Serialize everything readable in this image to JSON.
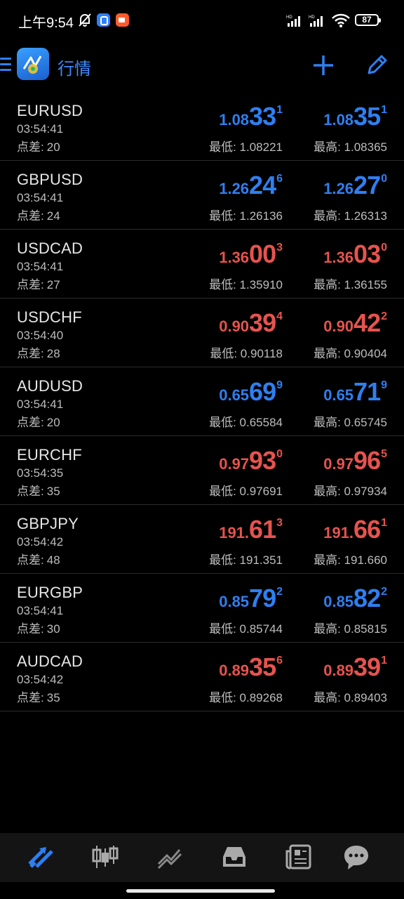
{
  "status_bar": {
    "time": "上午9:54",
    "battery": "87",
    "colors": {
      "app1": "#2f80ff",
      "app2": "#ff5a2c"
    },
    "icons": [
      "bell-off-icon",
      "app-icon",
      "video-icon",
      "hd-signal-icon",
      "hd-signal-icon",
      "wifi-icon",
      "battery-icon"
    ]
  },
  "app_bar": {
    "title": "行情",
    "icons": [
      "menu-icon",
      "metatrader-logo",
      "add-icon",
      "edit-icon"
    ]
  },
  "accent_color": "#2f7ff0",
  "down_color": "#e6534e",
  "quotes": [
    {
      "symbol": "EURUSD",
      "time": "03:54:41",
      "spread_label": "点差:",
      "spread": "20",
      "bid": {
        "pre": "1.08",
        "big": "33",
        "sup": "1",
        "color": "blue"
      },
      "ask": {
        "pre": "1.08",
        "big": "35",
        "sup": "1",
        "color": "blue"
      },
      "low": "最低: 1.08221",
      "high": "最高: 1.08365"
    },
    {
      "symbol": "GBPUSD",
      "time": "03:54:41",
      "spread_label": "点差:",
      "spread": "24",
      "bid": {
        "pre": "1.26",
        "big": "24",
        "sup": "6",
        "color": "blue"
      },
      "ask": {
        "pre": "1.26",
        "big": "27",
        "sup": "0",
        "color": "blue"
      },
      "low": "最低: 1.26136",
      "high": "最高: 1.26313"
    },
    {
      "symbol": "USDCAD",
      "time": "03:54:41",
      "spread_label": "点差:",
      "spread": "27",
      "bid": {
        "pre": "1.36",
        "big": "00",
        "sup": "3",
        "color": "red"
      },
      "ask": {
        "pre": "1.36",
        "big": "03",
        "sup": "0",
        "color": "red"
      },
      "low": "最低: 1.35910",
      "high": "最高: 1.36155"
    },
    {
      "symbol": "USDCHF",
      "time": "03:54:40",
      "spread_label": "点差:",
      "spread": "28",
      "bid": {
        "pre": "0.90",
        "big": "39",
        "sup": "4",
        "color": "red"
      },
      "ask": {
        "pre": "0.90",
        "big": "42",
        "sup": "2",
        "color": "red"
      },
      "low": "最低: 0.90118",
      "high": "最高: 0.90404"
    },
    {
      "symbol": "AUDUSD",
      "time": "03:54:41",
      "spread_label": "点差:",
      "spread": "20",
      "bid": {
        "pre": "0.65",
        "big": "69",
        "sup": "9",
        "color": "blue"
      },
      "ask": {
        "pre": "0.65",
        "big": "71",
        "sup": "9",
        "color": "blue"
      },
      "low": "最低: 0.65584",
      "high": "最高: 0.65745"
    },
    {
      "symbol": "EURCHF",
      "time": "03:54:35",
      "spread_label": "点差:",
      "spread": "35",
      "bid": {
        "pre": "0.97",
        "big": "93",
        "sup": "0",
        "color": "red"
      },
      "ask": {
        "pre": "0.97",
        "big": "96",
        "sup": "5",
        "color": "red"
      },
      "low": "最低: 0.97691",
      "high": "最高: 0.97934"
    },
    {
      "symbol": "GBPJPY",
      "time": "03:54:42",
      "spread_label": "点差:",
      "spread": "48",
      "bid": {
        "pre": "191.",
        "big": "61",
        "sup": "3",
        "color": "red"
      },
      "ask": {
        "pre": "191.",
        "big": "66",
        "sup": "1",
        "color": "red"
      },
      "low": "最低: 191.351",
      "high": "最高: 191.660"
    },
    {
      "symbol": "EURGBP",
      "time": "03:54:41",
      "spread_label": "点差:",
      "spread": "30",
      "bid": {
        "pre": "0.85",
        "big": "79",
        "sup": "2",
        "color": "blue"
      },
      "ask": {
        "pre": "0.85",
        "big": "82",
        "sup": "2",
        "color": "blue"
      },
      "low": "最低: 0.85744",
      "high": "最高: 0.85815"
    },
    {
      "symbol": "AUDCAD",
      "time": "03:54:42",
      "spread_label": "点差:",
      "spread": "35",
      "bid": {
        "pre": "0.89",
        "big": "35",
        "sup": "6",
        "color": "red"
      },
      "ask": {
        "pre": "0.89",
        "big": "39",
        "sup": "1",
        "color": "red"
      },
      "low": "最低: 0.89268",
      "high": "最高: 0.89403"
    }
  ],
  "bottom_nav": {
    "items": [
      "quotes-icon",
      "chart-icon",
      "trade-icon",
      "history-icon",
      "news-icon",
      "messages-icon"
    ],
    "active_index": 0
  }
}
